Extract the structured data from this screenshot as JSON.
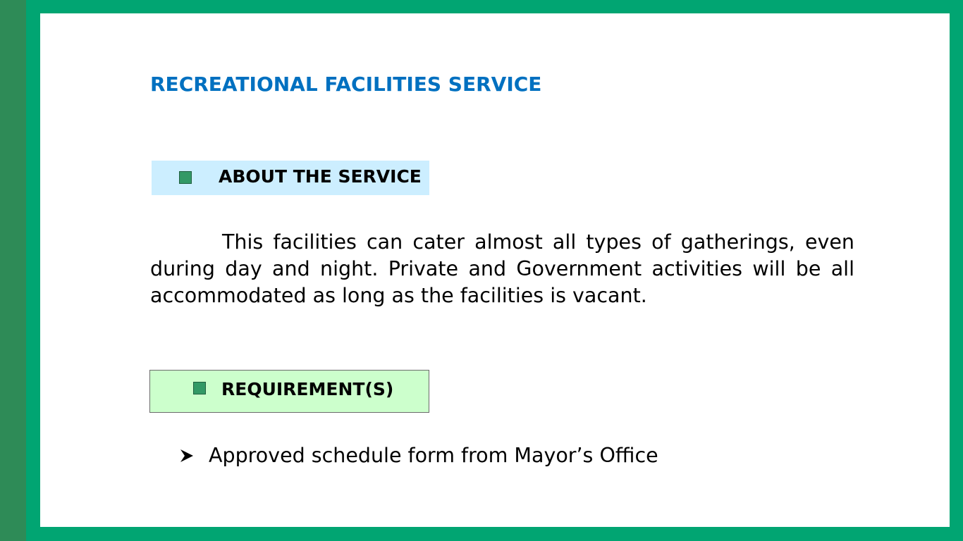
{
  "colors": {
    "frame": "#01a572",
    "left_band": "#2e8b57",
    "title": "#0070c0",
    "about_box_fill": "#cceeff",
    "requirements_box_fill": "#ccffcc",
    "bullet_square": "#339966"
  },
  "slide": {
    "title": "RECREATIONAL FACILITIES SERVICE",
    "about": {
      "icon": "square-bullet-icon",
      "label": "ABOUT THE SERVICE",
      "text": "This facilities can cater almost all types of gatherings, even during day and night. Private and Government activities will be all accommodated as long as the facilities is vacant."
    },
    "requirements": {
      "icon": "square-bullet-icon",
      "label": "REQUIREMENT(S)",
      "bullet_icon": "arrowhead-bullet-icon",
      "items": [
        "Approved schedule form from Mayor’s Office"
      ]
    }
  }
}
